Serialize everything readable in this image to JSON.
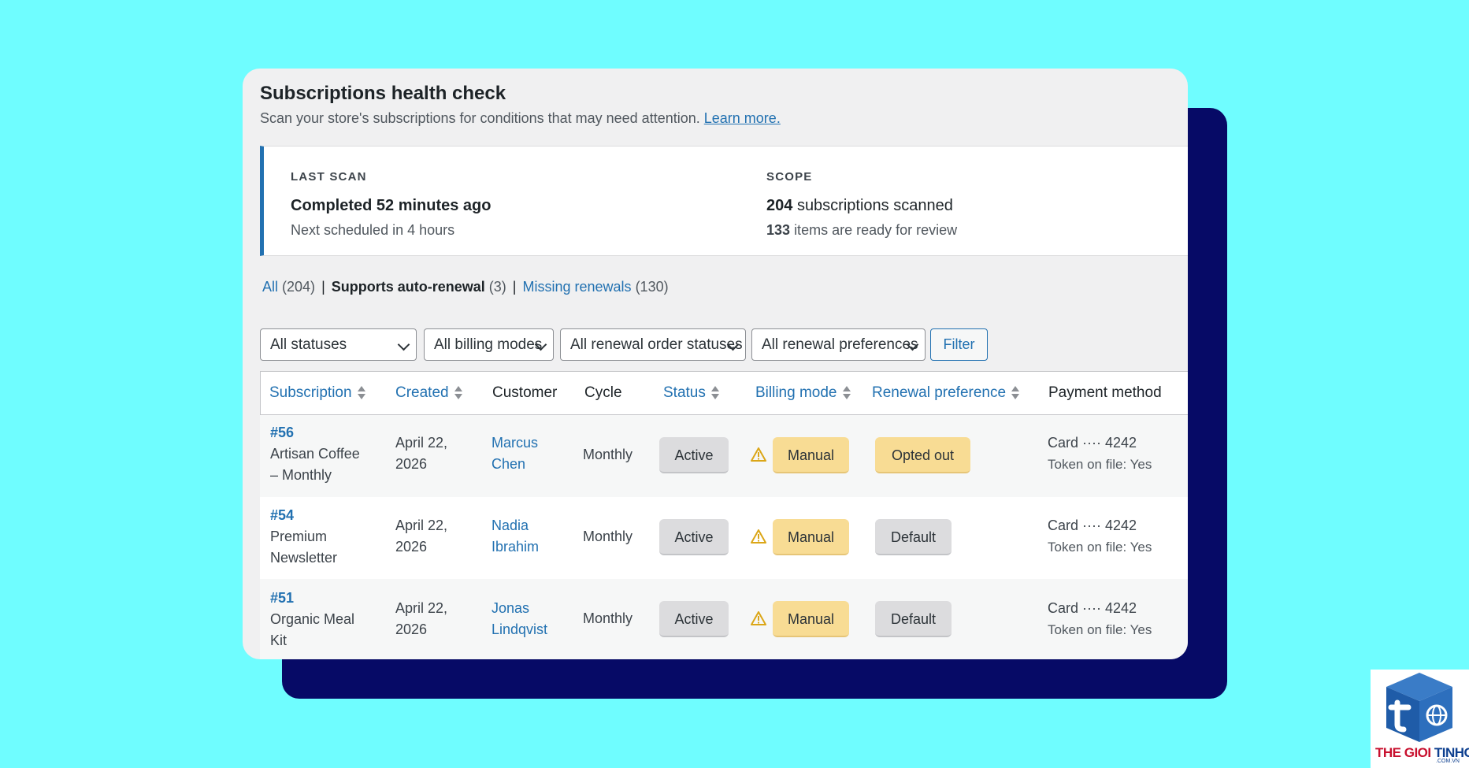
{
  "header": {
    "title": "Subscriptions health check",
    "description": "Scan your store's subscriptions for conditions that may need attention.",
    "learn_more": "Learn more."
  },
  "scan": {
    "last_scan_heading": "LAST SCAN",
    "last_scan_status": "Completed 52 minutes ago",
    "next_scheduled": "Next scheduled in 4 hours",
    "scope_heading": "SCOPE",
    "scanned_count": "204",
    "scanned_text": "subscriptions scanned",
    "review_count": "133",
    "review_text": "items are ready for review"
  },
  "views": [
    {
      "label": "All",
      "count": "(204)",
      "current": false
    },
    {
      "label": "Supports auto-renewal",
      "count": "(3)",
      "current": true
    },
    {
      "label": "Missing renewals",
      "count": "(130)",
      "current": false
    }
  ],
  "filters": {
    "status": "All statuses",
    "billing_mode": "All billing modes",
    "renewal_order_status": "All renewal order statuses",
    "renewal_preference": "All renewal preferences",
    "button": "Filter"
  },
  "columns": {
    "subscription": "Subscription",
    "created": "Created",
    "customer": "Customer",
    "cycle": "Cycle",
    "status": "Status",
    "billing_mode": "Billing mode",
    "renewal_preference": "Renewal preference",
    "payment_method": "Payment method"
  },
  "rows": [
    {
      "id": "#56",
      "name_1": "Artisan Coffee",
      "name_2": "– Monthly",
      "created_1": "April 22,",
      "created_2": "2026",
      "customer_1": "Marcus",
      "customer_2": "Chen",
      "cycle": "Monthly",
      "status": "Active",
      "billing_mode": "Manual",
      "renewal_preference": "Opted out",
      "payment": "Card ···· 4242",
      "token": "Token on file: Yes"
    },
    {
      "id": "#54",
      "name_1": "Premium",
      "name_2": "Newsletter",
      "created_1": "April 22,",
      "created_2": "2026",
      "customer_1": "Nadia",
      "customer_2": "Ibrahim",
      "cycle": "Monthly",
      "status": "Active",
      "billing_mode": "Manual",
      "renewal_preference": "Default",
      "payment": "Card ···· 4242",
      "token": "Token on file: Yes"
    },
    {
      "id": "#51",
      "name_1": "Organic Meal",
      "name_2": "Kit",
      "created_1": "April 22,",
      "created_2": "2026",
      "customer_1": "Jonas",
      "customer_2": "Lindqvist",
      "cycle": "Monthly",
      "status": "Active",
      "billing_mode": "Manual",
      "renewal_preference": "Default",
      "payment": "Card ···· 4242",
      "token": "Token on file: Yes"
    }
  ],
  "watermark": {
    "text_a": "THE GIOI ",
    "text_b": "TINHOC",
    "domain": ".COM.VN"
  },
  "colors": {
    "background": "#6ffdff",
    "shadow_block": "#060a66",
    "accent_blue": "#2271b1",
    "warning_badge": "#f8dc94",
    "neutral_badge": "#dcdcde"
  }
}
